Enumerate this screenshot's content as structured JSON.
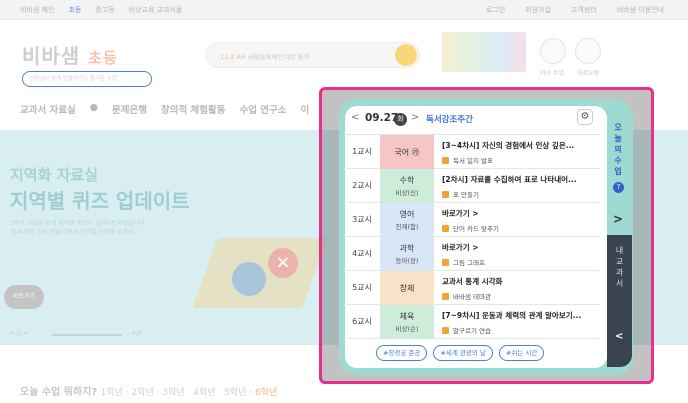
{
  "schedule": {
    "date": "09.27",
    "weekday": "화",
    "event": "독서강조주간",
    "rows": [
      {
        "period": "1교시",
        "subject": "국어 ㉮",
        "publisher": "",
        "lesson": "[3~4차시] 자신의 경험에서 인상 깊은...",
        "activity": "독서 일지 발표",
        "color": "#f6c5c5"
      },
      {
        "period": "2교시",
        "subject": "수학",
        "publisher": "비상(신)",
        "lesson": "[2차시] 자료를 수집하여 표로 나타내어...",
        "activity": "표 만들기",
        "color": "#cdecd9"
      },
      {
        "period": "3교시",
        "subject": "영어",
        "publisher": "천재(함)",
        "lesson": "바로가기 >",
        "activity": "단어 카드 맞추기",
        "color": "#d9e6f8"
      },
      {
        "period": "4교시",
        "subject": "과학",
        "publisher": "동아(장)",
        "lesson": "바로가기 >",
        "activity": "그림 그래프",
        "color": "#d9e6f8"
      },
      {
        "period": "5교시",
        "subject": "창체",
        "publisher": "",
        "lesson": "교과서 통계 시각화",
        "activity": "바바샘 테마관",
        "color": "#f9e3c8"
      },
      {
        "period": "6교시",
        "subject": "체육",
        "publisher": "비상(손)",
        "lesson": "[7~9차시] 운동과 체력의 관계 알아보기...",
        "activity": "말구르기 연습",
        "color": "#cdecd9"
      }
    ],
    "tags": [
      "#창경궁 준공",
      "#세계 관광의 날",
      "#쉬는 시간"
    ]
  },
  "side": {
    "today": [
      "오",
      "늘",
      "의",
      "수",
      "업"
    ],
    "help": "?",
    "next": ">",
    "my_textbook": [
      "내",
      "교",
      "과",
      "서"
    ],
    "collapse": "<"
  },
  "background": {
    "topbar_left": [
      "비바샘 메인",
      "초등",
      "중고등",
      "비상교육 교과서몰"
    ],
    "topbar_right": [
      "로그인",
      "회원가입",
      "고객센터",
      "비바샘 이용안내"
    ],
    "logo": "비바샘",
    "logo_sub": "초등",
    "logo_tag": "선생님의 함께 만들어가는 즐거운 수업",
    "search_highlight": "11.2",
    "search_text": "AR 서울블록체인이란 뭘까",
    "icon_labels": [
      "마이 수업",
      "자료요청"
    ],
    "nav": [
      "교과서 자료실",
      "●",
      "문제은행",
      "창의적 체험활동",
      "수업 연구소",
      "이"
    ],
    "hero_title1": "지역화 자료실",
    "hero_title2": "지역별 퀴즈 업데이트",
    "hero_desc1": "3학기 수업을 위해 지역화 퀴즈가 업데이트되었습니다.",
    "hero_desc2": "'우리지역' 지도 만들기에서 퀴즈를 이용해 보세요.",
    "hero_more": "바로가기",
    "hero_pager": "< || >",
    "hero_page": "4/6",
    "bottom_title": "오늘 수업 뭐하지?",
    "bottom_grades": "1학년 · 2학년 · 3학년 · 4학년 · 5학년 · ",
    "bottom_selected": "6학년"
  }
}
